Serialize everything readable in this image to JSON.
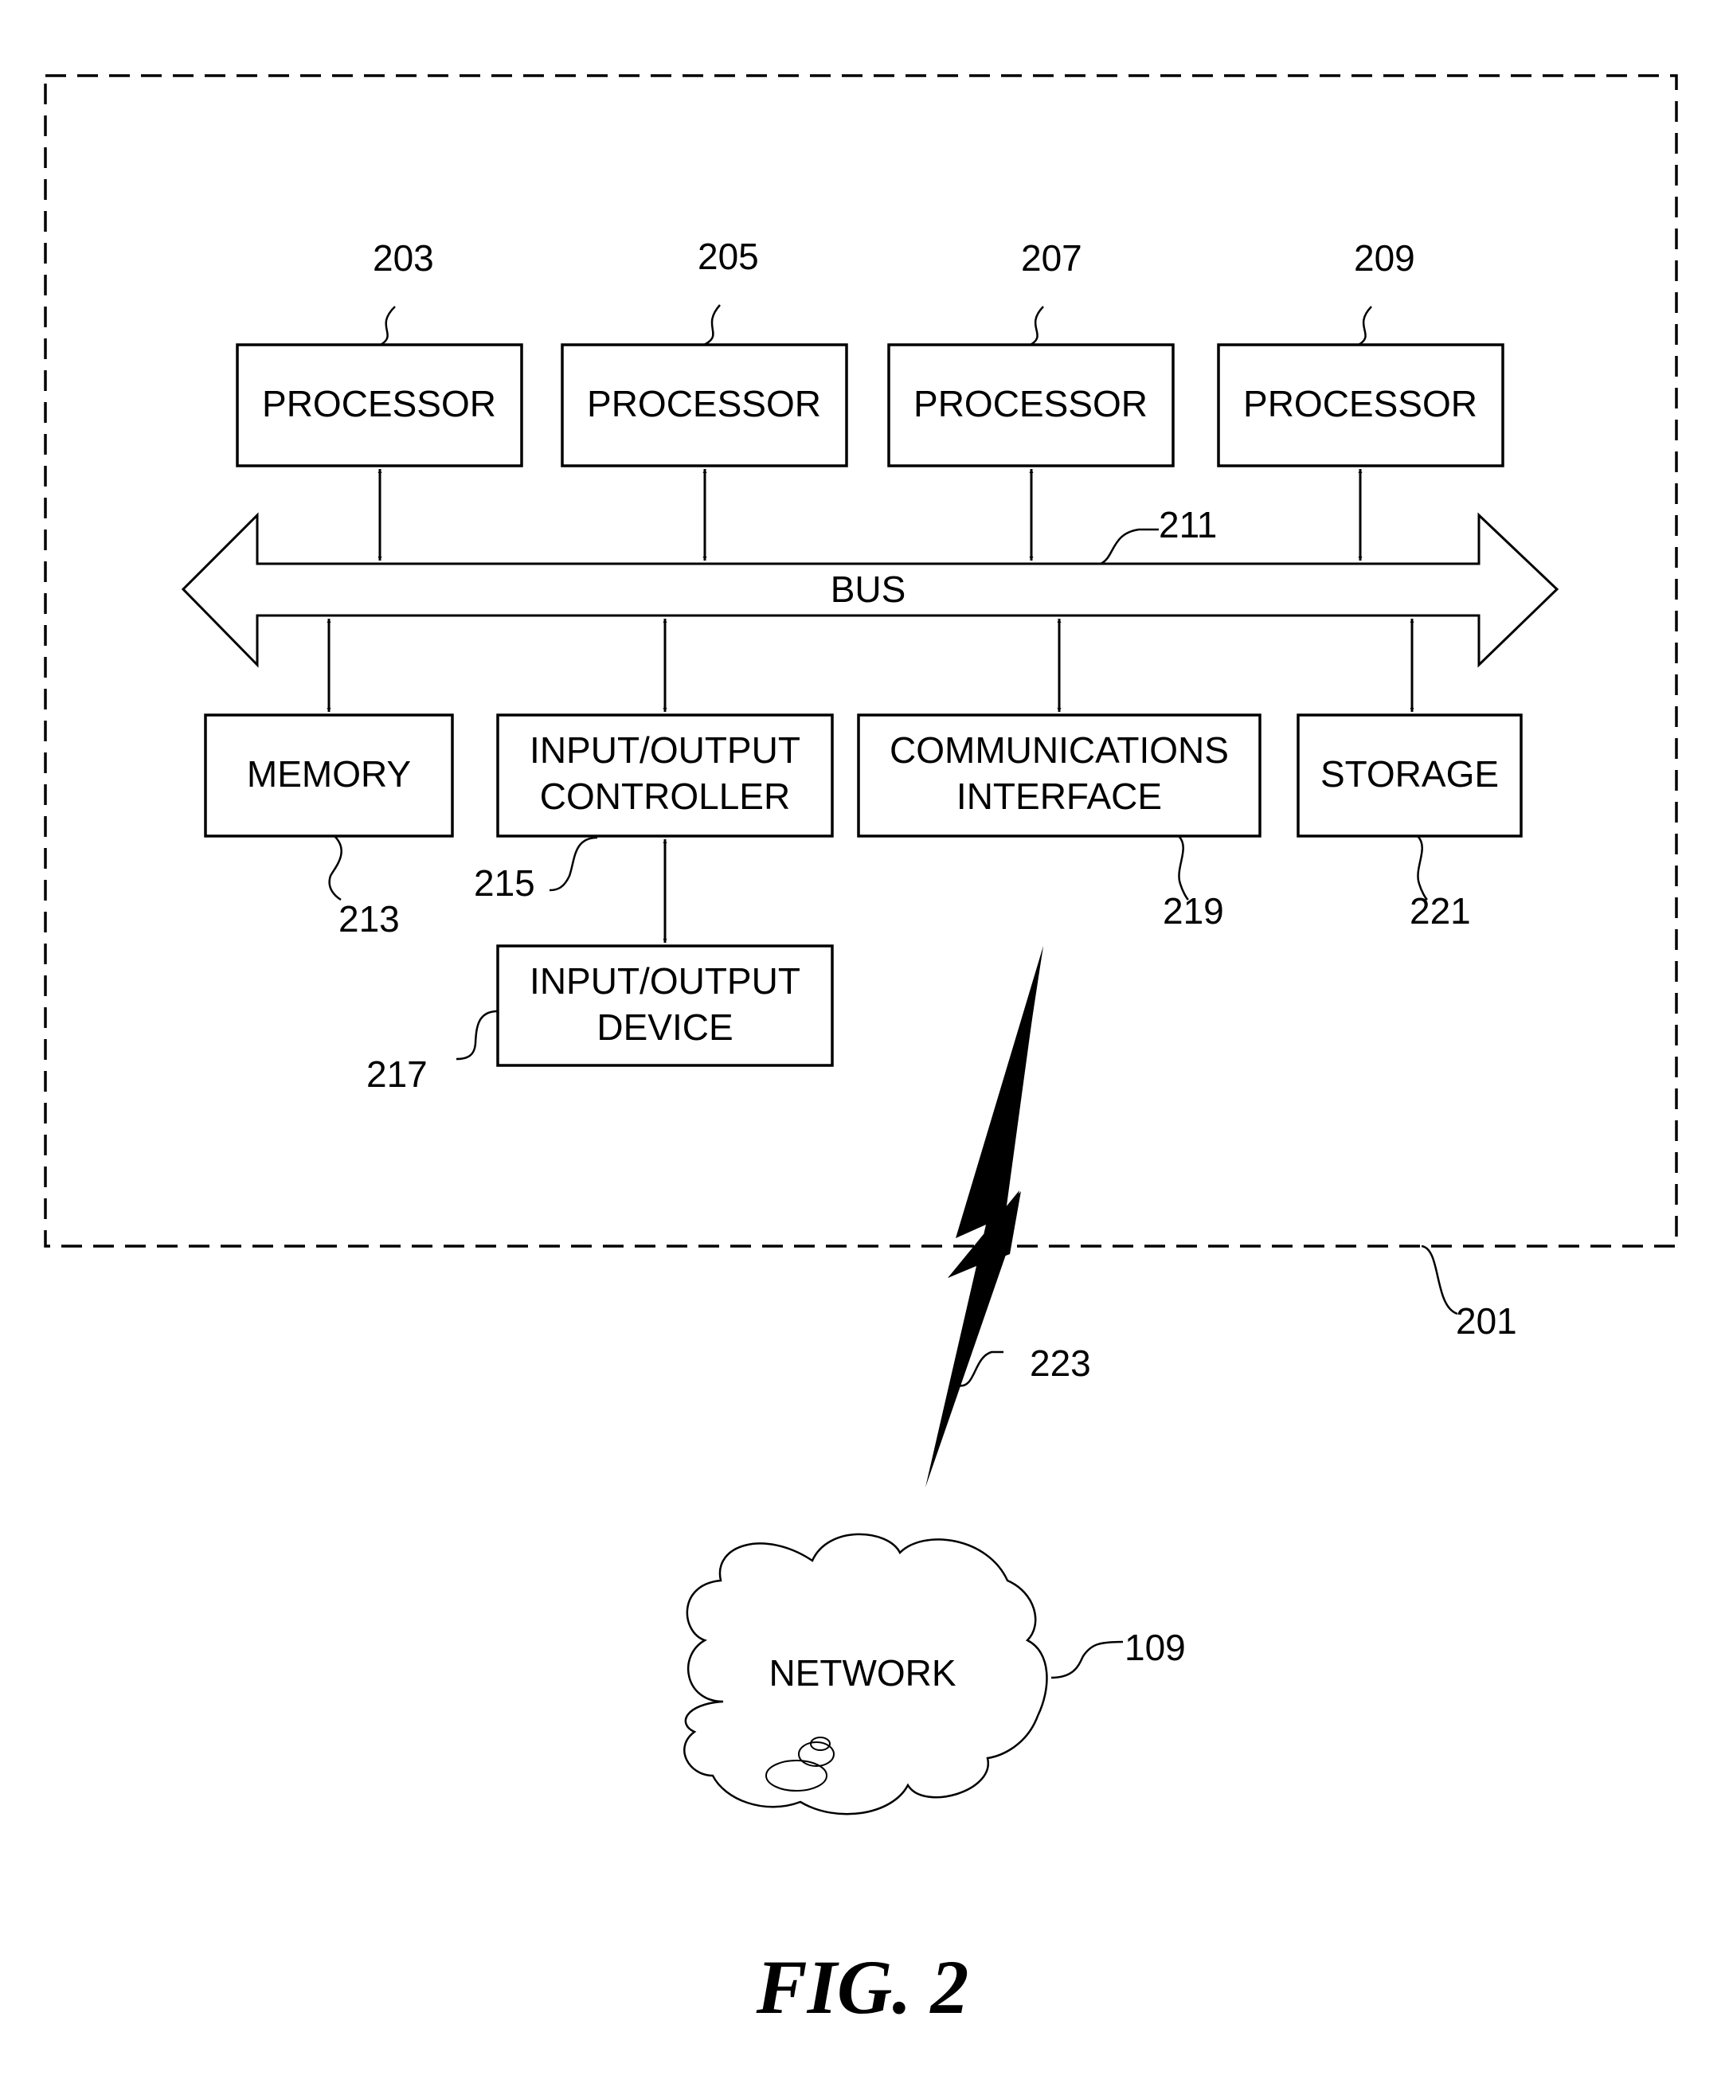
{
  "figure": {
    "caption": "FIG. 2",
    "system": {
      "ref": "201"
    },
    "processors": [
      {
        "label": "PROCESSOR",
        "ref": "203"
      },
      {
        "label": "PROCESSOR",
        "ref": "205"
      },
      {
        "label": "PROCESSOR",
        "ref": "207"
      },
      {
        "label": "PROCESSOR",
        "ref": "209"
      }
    ],
    "bus": {
      "label": "BUS",
      "ref": "211"
    },
    "memory": {
      "label": "MEMORY",
      "ref": "213"
    },
    "io_controller": {
      "label_line1": "INPUT/OUTPUT",
      "label_line2": "CONTROLLER",
      "ref": "215"
    },
    "io_device": {
      "label_line1": "INPUT/OUTPUT",
      "label_line2": "DEVICE",
      "ref": "217"
    },
    "comm_interface": {
      "label_line1": "COMMUNICATIONS",
      "label_line2": "INTERFACE",
      "ref": "219"
    },
    "storage": {
      "label": "STORAGE",
      "ref": "221"
    },
    "wireless_link": {
      "ref": "223"
    },
    "network": {
      "label": "NETWORK",
      "ref": "109"
    }
  }
}
